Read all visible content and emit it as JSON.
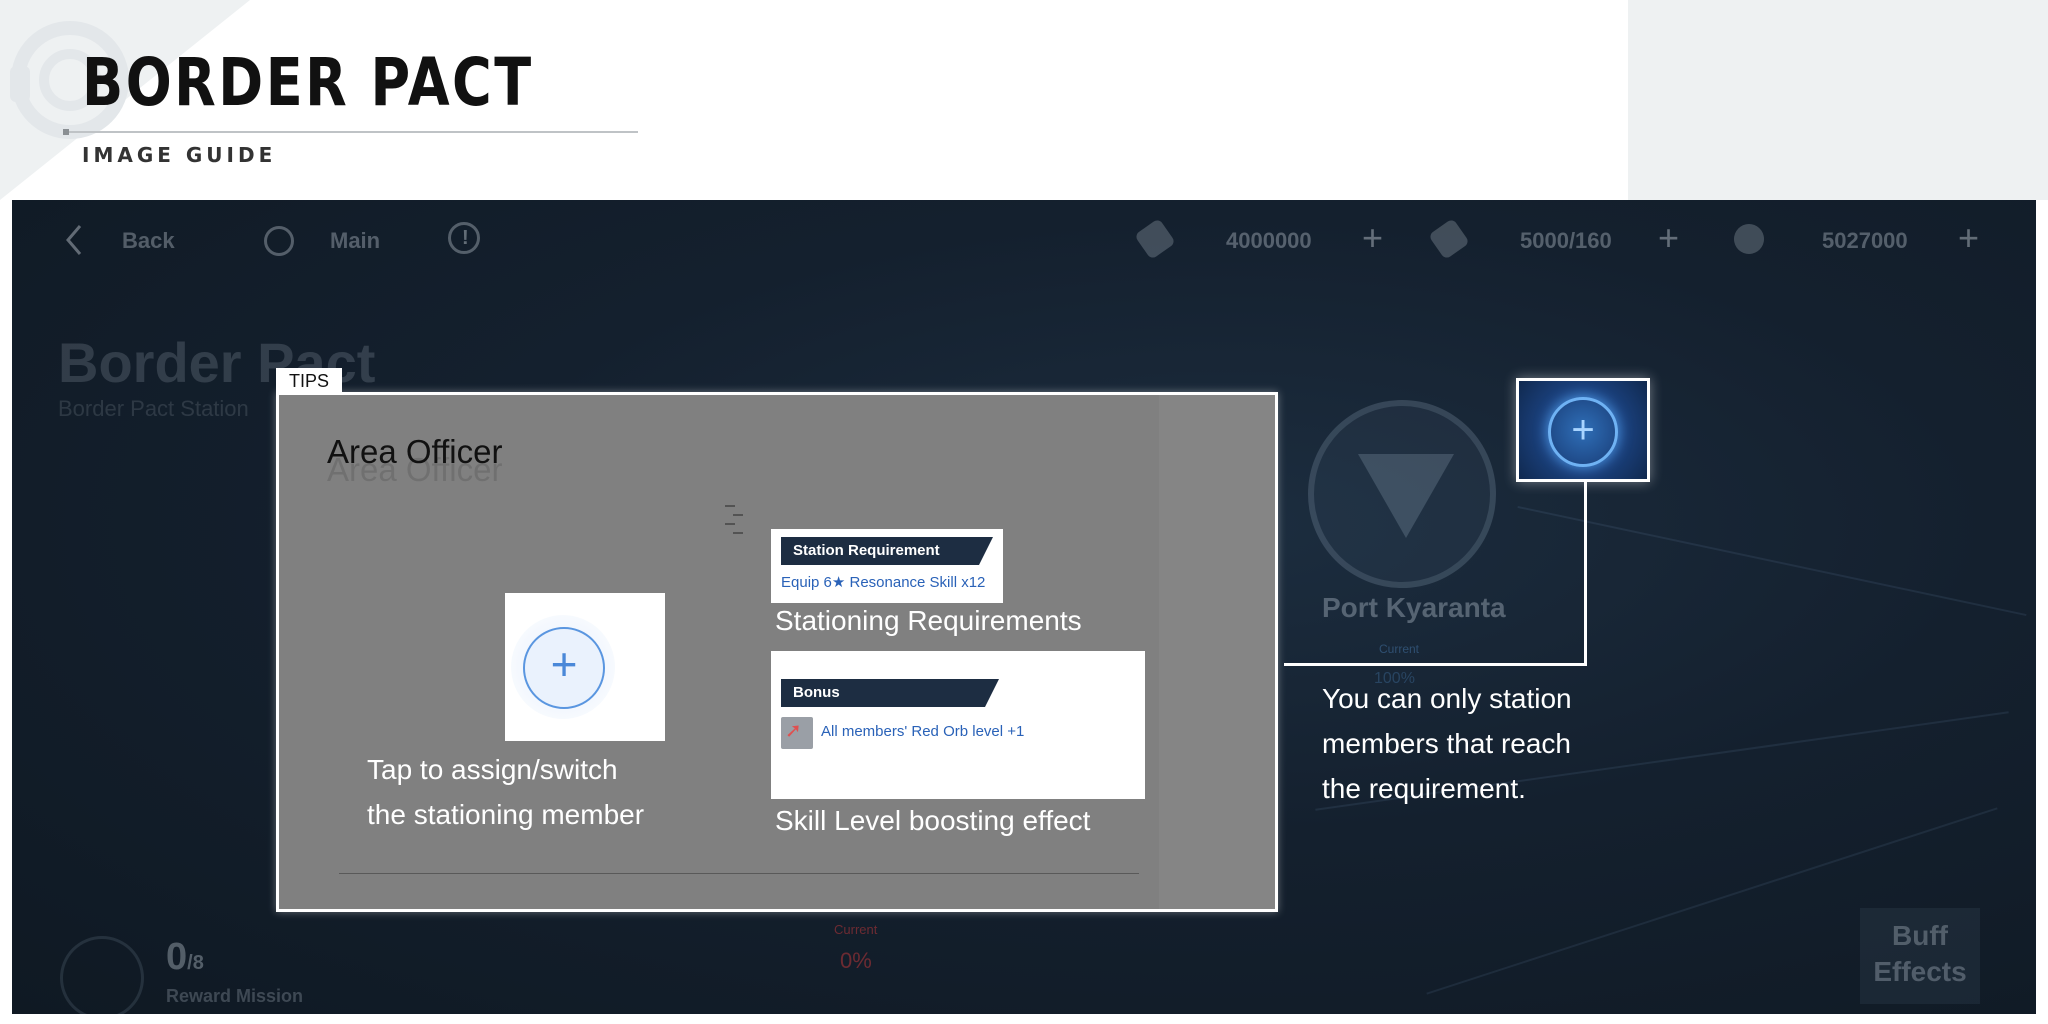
{
  "guide": {
    "title": "BORDER PACT",
    "subtitle": "IMAGE GUIDE",
    "icon": "headset-icon"
  },
  "topbar": {
    "back_label": "Back",
    "main_label": "Main",
    "info_icon": "info-icon",
    "resources": [
      {
        "icon": "ticket-icon",
        "value": "4000000"
      },
      {
        "icon": "battery-icon",
        "value": "5000/160"
      },
      {
        "icon": "coin-icon",
        "value": "5027000"
      }
    ]
  },
  "background": {
    "title": "Border Pact",
    "subtitle": "Border Pact Station",
    "port_name": "Port Kyaranta",
    "port_current_label": "Current",
    "port_current_value": "100%",
    "reward_count": "0",
    "reward_total": "/8",
    "reward_label": "Reward Mission",
    "bottom_current_label": "Current",
    "bottom_current_value": "0%",
    "buff_label_1": "Buff",
    "buff_label_2": "Effects"
  },
  "tips": {
    "label": "TIPS",
    "area_title": "Area Officer",
    "assign_note_line1": "Tap to assign/switch",
    "assign_note_line2": "the stationing member",
    "requirement_header": "Station Requirement",
    "requirement_text": "Equip 6★ Resonance Skill x12",
    "requirement_caption": "Stationing Requirements",
    "bonus_header": "Bonus",
    "bonus_text": "All  members' Red Orb level +1",
    "bonus_caption": "Skill Level boosting effect"
  },
  "callout": {
    "line1": "You can only station",
    "line2": "members that reach",
    "line3": "the requirement."
  }
}
